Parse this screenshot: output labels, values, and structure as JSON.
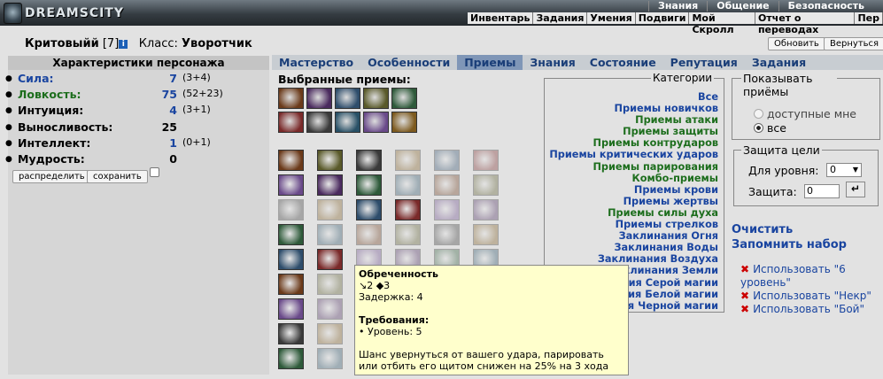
{
  "header": {
    "logo": "DREAMSCITY",
    "menu": [
      "Знания",
      "Общение",
      "Безопасность"
    ],
    "submenu": [
      "Инвентарь",
      "Задания",
      "Умения",
      "Подвиги",
      "Мой Скролл",
      "Отчет о переводах",
      "Пер"
    ]
  },
  "character": {
    "name": "Критовыйй",
    "level": "[7]",
    "class_label": "Класс:",
    "class_value": "Уворотчик"
  },
  "buttons": {
    "refresh": "Обновить",
    "back": "Вернуться",
    "distribute": "распределить",
    "save": "сохранить"
  },
  "stats": {
    "title": "Характеристики персонажа",
    "items": [
      {
        "name": "Сила:",
        "value": "7",
        "bonus": "(3+4)",
        "color": "#1a45a0"
      },
      {
        "name": "Ловкость:",
        "value": "75",
        "bonus": "(52+23)",
        "color": "#1d6e1d"
      },
      {
        "name": "Интуиция:",
        "value": "4",
        "bonus": "(3+1)",
        "color": "#000"
      },
      {
        "name": "Выносливость:",
        "value": "25",
        "bonus": "",
        "color": "#000"
      },
      {
        "name": "Интеллект:",
        "value": "1",
        "bonus": "(0+1)",
        "color": "#000"
      },
      {
        "name": "Мудрость:",
        "value": "0",
        "bonus": "",
        "color": "#000"
      }
    ]
  },
  "tabs": [
    "Мастерство",
    "Особенности",
    "Приемы",
    "Знания",
    "Состояние",
    "Репутация",
    "Задания"
  ],
  "active_tab": "Приемы",
  "selected_title": "Выбранные приемы:",
  "categories": {
    "legend": "Категории",
    "items": [
      {
        "label": "Все",
        "style": "b"
      },
      {
        "label": "Приемы новичков",
        "style": "b"
      },
      {
        "label": "Приемы атаки",
        "style": "g"
      },
      {
        "label": "Приемы защиты",
        "style": "g"
      },
      {
        "label": "Приемы контрударов",
        "style": "g"
      },
      {
        "label": "Приемы критических ударов",
        "style": "b"
      },
      {
        "label": "Приемы парирования",
        "style": "g"
      },
      {
        "label": "Комбо-приемы",
        "style": "g"
      },
      {
        "label": "Приемы крови",
        "style": "b"
      },
      {
        "label": "Приемы жертвы",
        "style": "b"
      },
      {
        "label": "Приемы силы духа",
        "style": "g"
      },
      {
        "label": "Приемы стрелков",
        "style": "b"
      },
      {
        "label": "Заклинания Огня",
        "style": "b"
      },
      {
        "label": "Заклинания Воды",
        "style": "b"
      },
      {
        "label": "Заклинания Воздуха",
        "style": "b"
      },
      {
        "label": "Заклинания Земли",
        "style": "b"
      },
      {
        "label": "Заклинания Серой магии",
        "style": "b"
      },
      {
        "label": "Заклинания Белой магии",
        "style": "b"
      },
      {
        "label": "Заклинания Черной магии",
        "style": "b"
      }
    ]
  },
  "show": {
    "legend": "Показывать приёмы",
    "options": [
      "доступные мне",
      "все"
    ]
  },
  "defense": {
    "legend": "Защита цели",
    "level_label": "Для уровня:",
    "level_value": "0",
    "defense_label": "Защита:",
    "defense_value": "0"
  },
  "actions": {
    "clear": "Очистить",
    "remember": "Запомнить набор",
    "use": [
      "Использовать \"6 уровень\"",
      "Использовать \"Некр\"",
      "Использовать \"Бой\""
    ]
  },
  "tooltip": {
    "title": "Обреченность",
    "stats": "↘2 ◆3",
    "delay": "Задержка: 4",
    "req_title": "Требования:",
    "req": "• Уровень: 5",
    "desc": "Шанс увернуться от вашего удара, парировать или отбить его щитом снижен на 25% на 3 хода"
  }
}
